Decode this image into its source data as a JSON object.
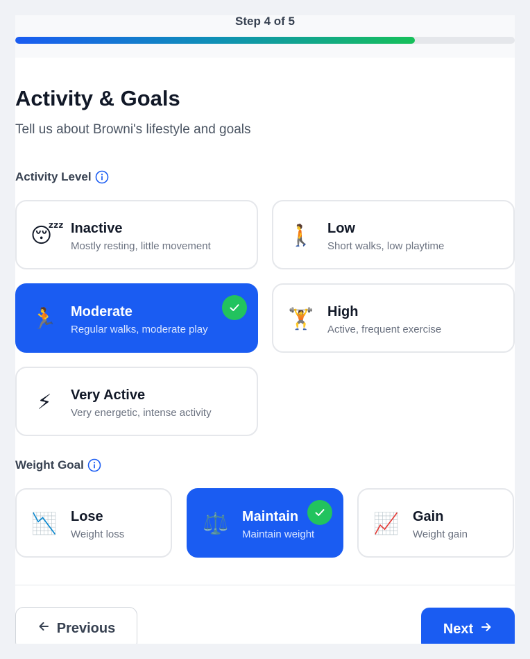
{
  "header": {
    "step_label": "Step 4 of 5",
    "progress_fraction": 0.8
  },
  "page": {
    "title": "Activity & Goals",
    "subtitle": "Tell us about Browni's lifestyle and goals"
  },
  "activity": {
    "label": "Activity Level",
    "selected": "Moderate",
    "options": [
      {
        "emoji": "😴",
        "icon": "sleeping-face-icon",
        "title": "Inactive",
        "desc": "Mostly resting, little movement"
      },
      {
        "emoji": "🚶",
        "icon": "walking-person-icon",
        "title": "Low",
        "desc": "Short walks, low playtime"
      },
      {
        "emoji": "🏃",
        "icon": "running-person-icon",
        "title": "Moderate",
        "desc": "Regular walks, moderate play"
      },
      {
        "emoji": "🏋️",
        "icon": "weightlifter-icon",
        "title": "High",
        "desc": "Active, frequent exercise"
      },
      {
        "emoji": "⚡",
        "icon": "lightning-icon",
        "title": "Very Active",
        "desc": "Very energetic, intense activity"
      }
    ]
  },
  "goal": {
    "label": "Weight Goal",
    "selected": "Maintain",
    "options": [
      {
        "emoji": "📉",
        "icon": "chart-decreasing-icon",
        "title": "Lose",
        "desc": "Weight loss"
      },
      {
        "emoji": "⚖️",
        "icon": "balance-scale-icon",
        "title": "Maintain",
        "desc": "Maintain weight"
      },
      {
        "emoji": "📈",
        "icon": "chart-increasing-icon",
        "title": "Gain",
        "desc": "Weight gain"
      }
    ]
  },
  "nav": {
    "previous_label": "Previous",
    "next_label": "Next"
  },
  "colors": {
    "primary": "#1a5cf2",
    "success": "#22c35e",
    "border": "#e5e7eb"
  }
}
